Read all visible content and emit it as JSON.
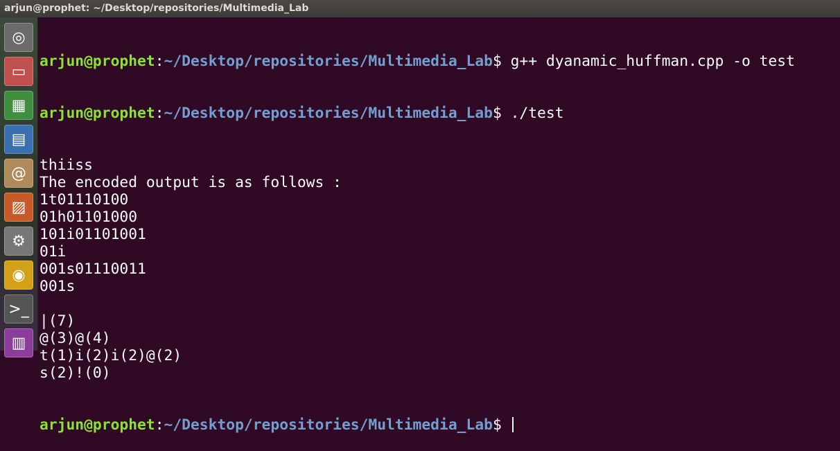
{
  "window": {
    "title": "arjun@prophet: ~/Desktop/repositories/Multimedia_Lab"
  },
  "launcher": [
    {
      "name": "ubuntu-dash-icon",
      "glyph": "◎"
    },
    {
      "name": "files-icon",
      "glyph": "▭"
    },
    {
      "name": "calc-icon",
      "glyph": "▦"
    },
    {
      "name": "writer-icon",
      "glyph": "▤"
    },
    {
      "name": "software-center-icon",
      "glyph": "@"
    },
    {
      "name": "impress-icon",
      "glyph": "▨"
    },
    {
      "name": "settings-icon",
      "glyph": "⚙"
    },
    {
      "name": "chrome-icon",
      "glyph": "◉"
    },
    {
      "name": "terminal-icon",
      "glyph": ">_"
    },
    {
      "name": "app-icon",
      "glyph": "▥"
    }
  ],
  "terminal": {
    "user": "arjun@prophet",
    "path": "~/Desktop/repositories/Multimedia_Lab",
    "cmd1": "g++ dyanamic_huffman.cpp -o test",
    "cmd2": "./test",
    "output": [
      "thiiss",
      "The encoded output is as follows :",
      "1t01110100",
      "01h01101000",
      "101i01101001",
      "01i",
      "001s01110011",
      "001s",
      "",
      "|(7)",
      "@(3)@(4)",
      "t(1)i(2)i(2)@(2)",
      "s(2)!(0)"
    ]
  }
}
